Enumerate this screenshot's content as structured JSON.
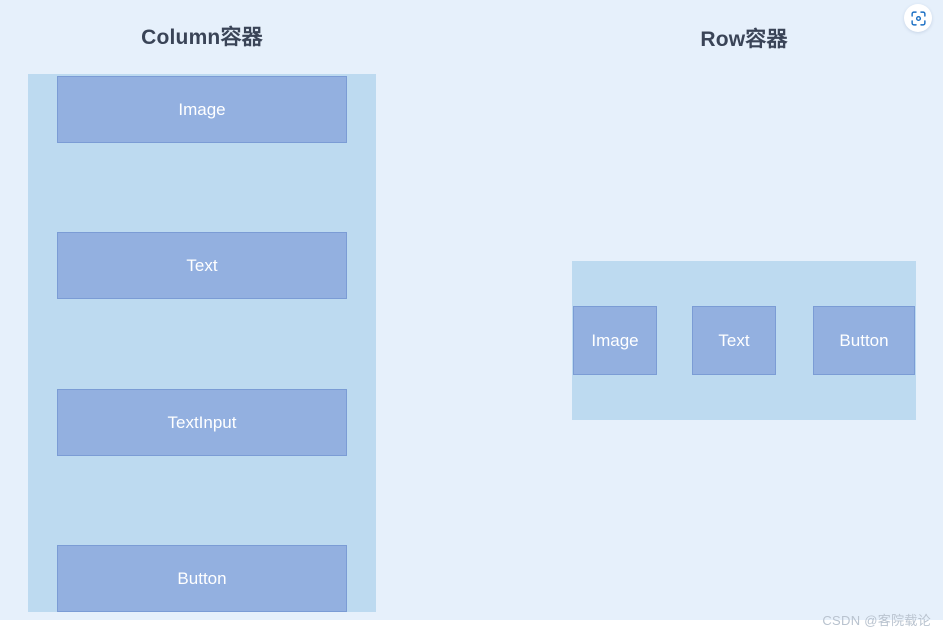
{
  "page": {
    "background_color": "#e6f0fb",
    "footer_background_color": "#ffffff"
  },
  "panels": [
    {
      "key": "column",
      "title": "Column容器",
      "container_color": "#bddaf0",
      "item_color": "#93b0e0",
      "item_border_color": "#7b9cd5",
      "direction": "column",
      "items": [
        {
          "label": "Image"
        },
        {
          "label": "Text"
        },
        {
          "label": "TextInput"
        },
        {
          "label": "Button"
        }
      ]
    },
    {
      "key": "row",
      "title": "Row容器",
      "container_color": "#bddaf0",
      "item_color": "#93b0e0",
      "item_border_color": "#7b9cd5",
      "direction": "row",
      "items": [
        {
          "label": "Image"
        },
        {
          "label": "Text"
        },
        {
          "label": "Button"
        }
      ]
    }
  ],
  "toolbar": {
    "scan_icon": "scan-code-icon",
    "scan_icon_color": "#1a6fc4"
  },
  "watermark": {
    "text": "CSDN @客院载论",
    "color": "#b9c3cf"
  }
}
